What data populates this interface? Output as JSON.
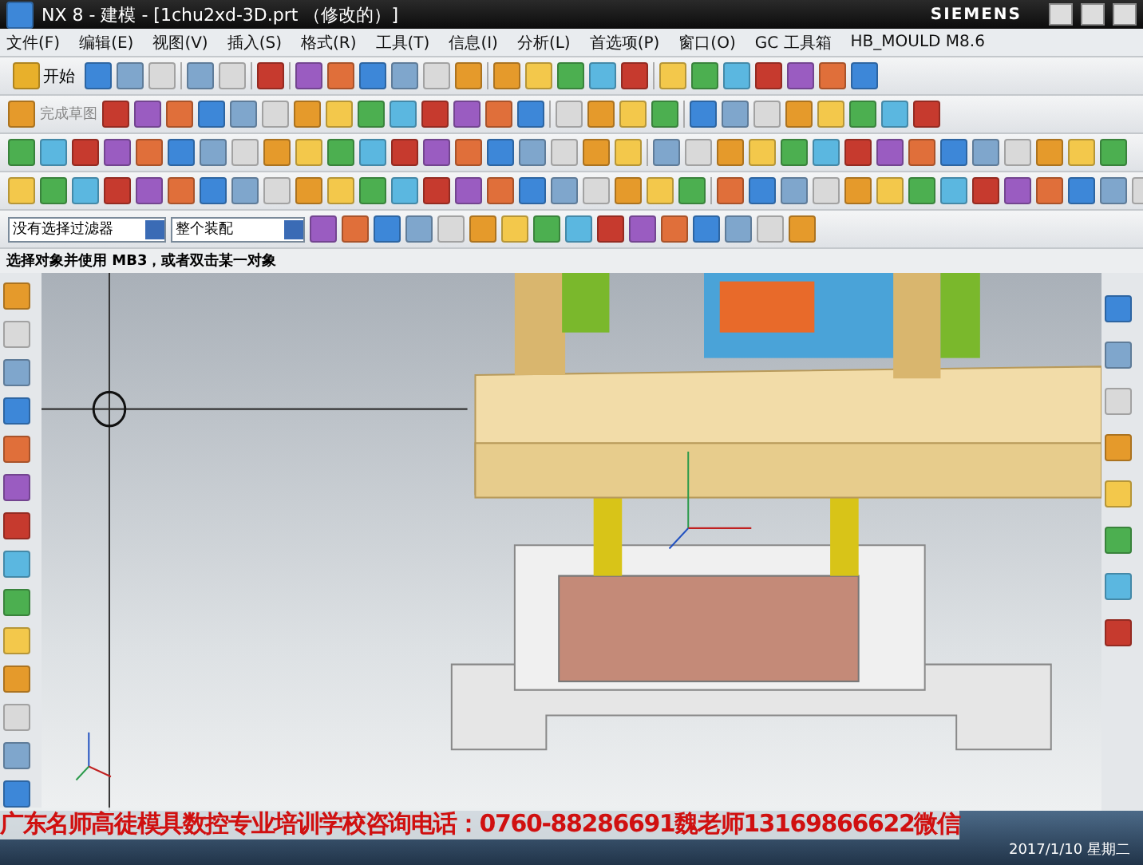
{
  "window": {
    "title": "NX 8 - 建模 - [1chu2xd-3D.prt （修改的）]",
    "brand": "SIEMENS"
  },
  "menu_bar": {
    "items": [
      {
        "label": "文件(F)"
      },
      {
        "label": "编辑(E)"
      },
      {
        "label": "视图(V)"
      },
      {
        "label": "插入(S)"
      },
      {
        "label": "格式(R)"
      },
      {
        "label": "工具(T)"
      },
      {
        "label": "信息(I)"
      },
      {
        "label": "分析(L)"
      },
      {
        "label": "首选项(P)"
      },
      {
        "label": "窗口(O)"
      },
      {
        "label": "GC 工具箱"
      },
      {
        "label": "HB_MOULD M8.6"
      }
    ]
  },
  "toolbar": {
    "start_button": "开始",
    "finish_sketch": "完成草图"
  },
  "selection_bar": {
    "filter": "没有选择过滤器",
    "scope": "整个装配"
  },
  "status_line": "选择对象并使用 MB3，或者双击某一对象",
  "banner": "广东名师高徒模具数控专业培训学校咨询电话：0760-88286691魏老师13169866622微信",
  "taskbar": {
    "clock": "2017/1/10 星期二"
  }
}
